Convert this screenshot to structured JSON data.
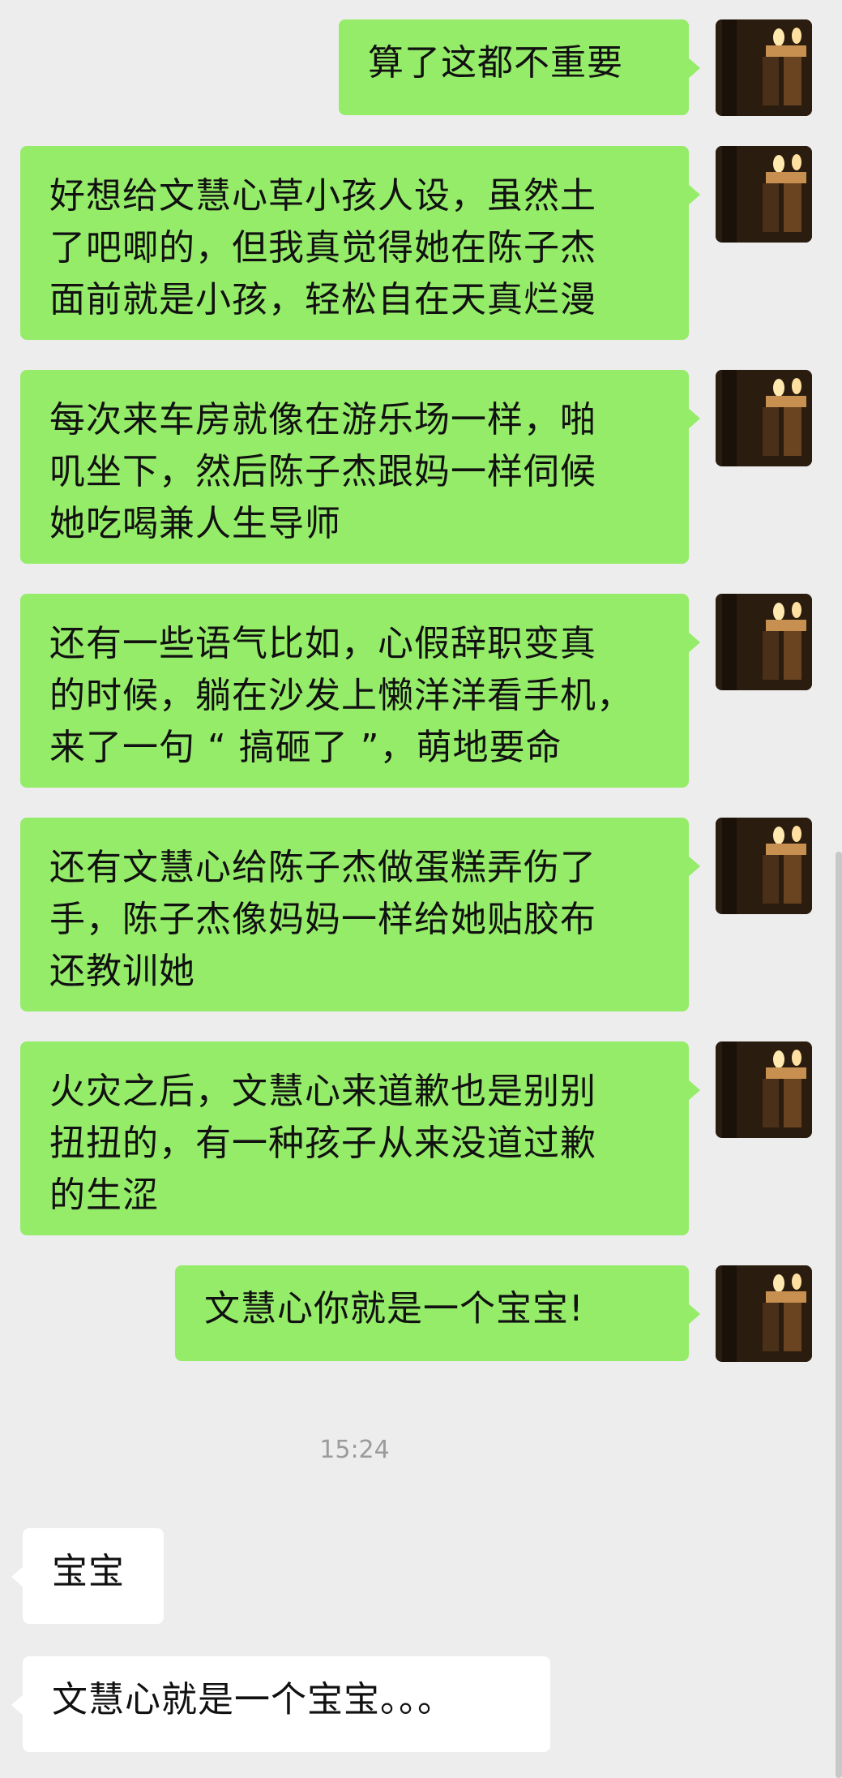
{
  "messages": [
    {
      "direction": "out",
      "lines": [
        "算了这都不重要"
      ]
    },
    {
      "direction": "out",
      "lines": [
        "好想给文慧心草小孩人设，虽然土",
        "了吧唧的，但我真觉得她在陈子杰",
        "面前就是小孩，轻松自在天真烂漫"
      ]
    },
    {
      "direction": "out",
      "lines": [
        "每次来车房就像在游乐场一样，啪",
        "叽坐下，然后陈子杰跟妈一样伺候",
        "她吃喝兼人生导师"
      ]
    },
    {
      "direction": "out",
      "lines": [
        "还有一些语气比如，心假辞职变真",
        "的时候，躺在沙发上懒洋洋看手机，",
        "来了一句 “ 搞砸了 ”，萌地要命"
      ]
    },
    {
      "direction": "out",
      "lines": [
        "还有文慧心给陈子杰做蛋糕弄伤了",
        "手，陈子杰像妈妈一样给她贴胶布",
        "还教训她"
      ]
    },
    {
      "direction": "out",
      "lines": [
        "火灾之后，文慧心来道歉也是别别",
        "扭扭的，有一种孩子从来没道过歉",
        "的生涩"
      ]
    },
    {
      "direction": "out",
      "lines": [
        "文慧心你就是一个宝宝!"
      ]
    },
    {
      "direction": "in",
      "lines": [
        "宝宝"
      ]
    },
    {
      "direction": "in",
      "lines": [
        "文慧心就是一个宝宝。。。"
      ]
    }
  ],
  "timestamp": "15:24",
  "avatar_icon": "candle-photo-avatar",
  "colors": {
    "out_bubble": "#95ec69",
    "in_bubble": "#ffffff",
    "background": "#ededed"
  }
}
